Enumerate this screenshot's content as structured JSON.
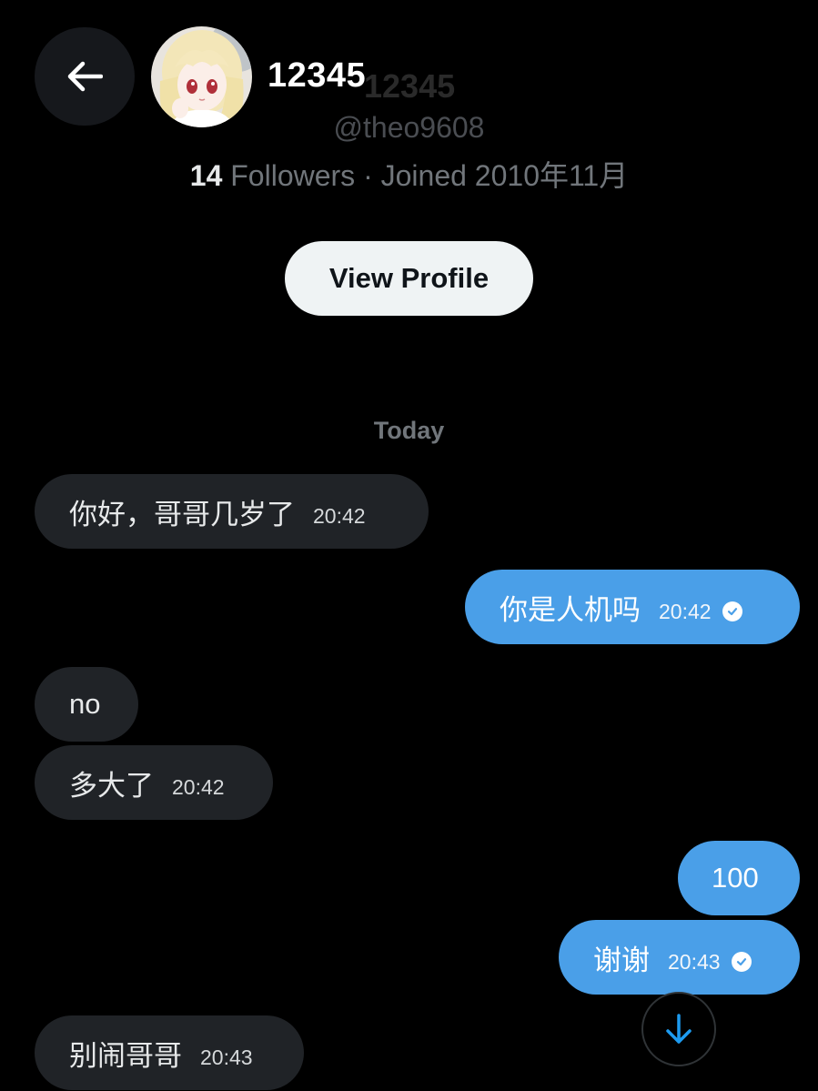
{
  "header": {
    "title": "12345",
    "handle": "@theo9608",
    "followers_count": "14",
    "followers_label": "Followers",
    "separator": "·",
    "joined_text": "Joined 2010年11月",
    "view_profile_label": "View Profile"
  },
  "icons": {
    "back": "arrow-left-icon",
    "avatar": "anime-doll-avatar",
    "read_receipt": "check-circle-icon",
    "scroll_down": "arrow-down-icon"
  },
  "colors": {
    "background": "#000000",
    "incoming_bubble": "#202327",
    "outgoing_bubble": "#4a9fe8",
    "accent": "#1d9bf0"
  },
  "chat": {
    "date_separator": "Today",
    "messages": [
      {
        "direction": "incoming",
        "text": "你好，哥哥几岁了",
        "time": "20:42"
      },
      {
        "direction": "outgoing",
        "text": "你是人机吗",
        "time": "20:42",
        "read": true
      },
      {
        "direction": "incoming",
        "text": "no",
        "time": ""
      },
      {
        "direction": "incoming",
        "text": "多大了",
        "time": "20:42"
      },
      {
        "direction": "outgoing",
        "text": "100",
        "time": ""
      },
      {
        "direction": "outgoing",
        "text": "谢谢",
        "time": "20:43",
        "read": true
      },
      {
        "direction": "incoming",
        "text": "别闹哥哥",
        "time": "20:43"
      }
    ]
  }
}
